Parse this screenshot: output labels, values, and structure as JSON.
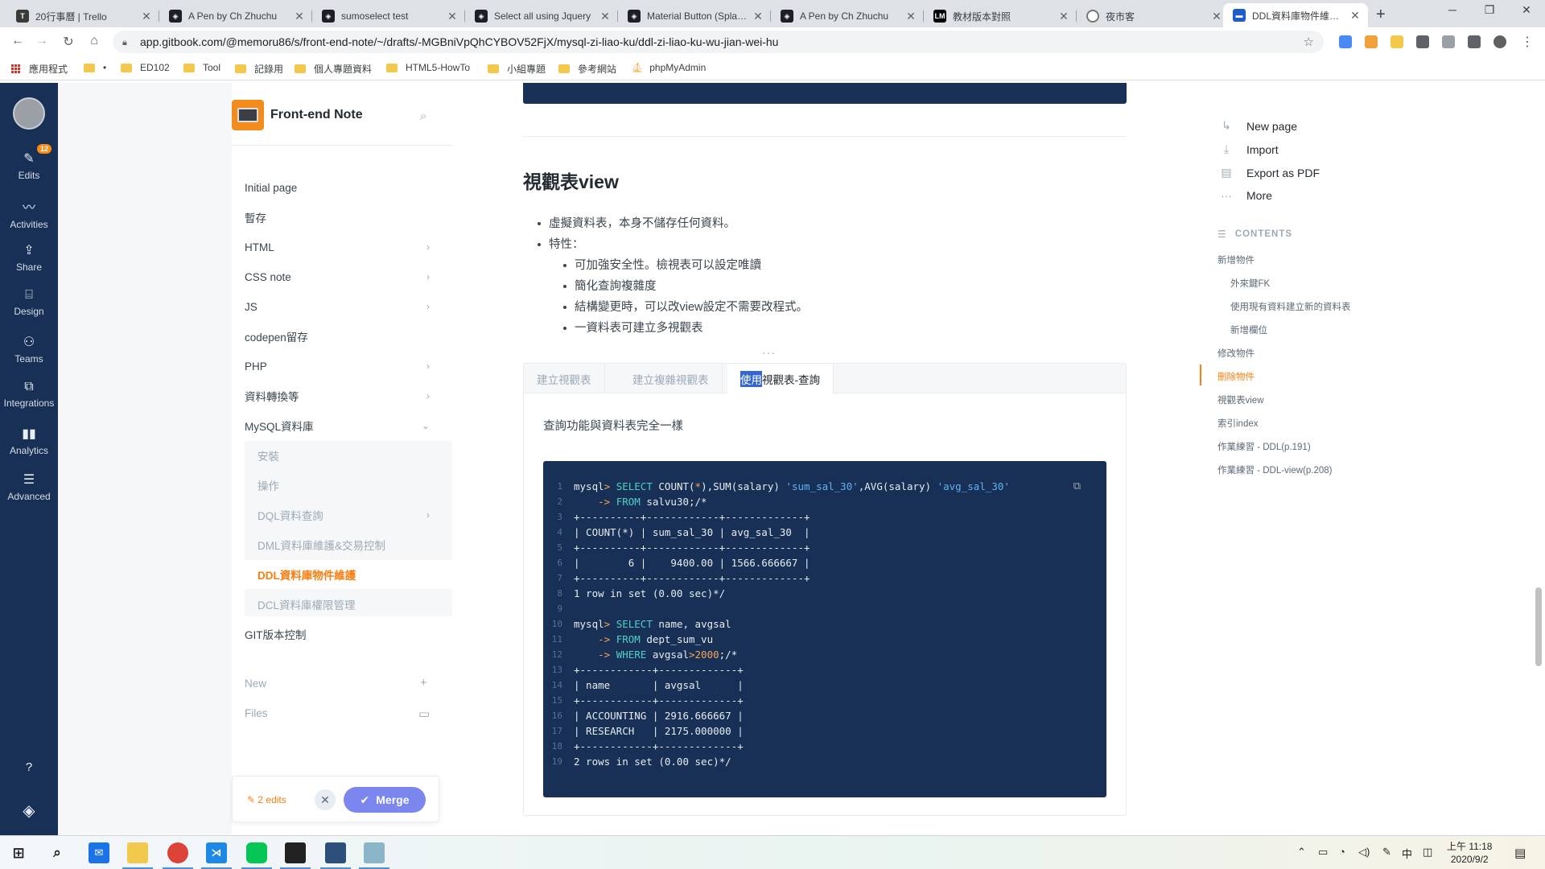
{
  "browser": {
    "tabs": [
      {
        "title": "20行事曆 | Trello",
        "icon_color": "#3a3a3a"
      },
      {
        "title": "A Pen by Ch Zhuchu",
        "icon_color": "#1e1f26"
      },
      {
        "title": "sumoselect test",
        "icon_color": "#1e1f26"
      },
      {
        "title": "Select all using Jquery",
        "icon_color": "#1e1f26"
      },
      {
        "title": "Material Button (Splash)",
        "icon_color": "#1e1f26"
      },
      {
        "title": "A Pen by Ch Zhuchu",
        "icon_color": "#1e1f26"
      },
      {
        "title": "教材版本對照",
        "icon_color": "#000000"
      },
      {
        "title": "夜市客",
        "icon_color": "#777777"
      },
      {
        "title": "DDL資料庫物件維護 - Fron",
        "icon_color": "#1e5bcc"
      }
    ],
    "url": "app.gitbook.com/@memoru86/s/front-end-note/~/drafts/-MGBniVpQhCYBOV52FjX/mysql-zi-liao-ku/ddl-zi-liao-ku-wu-jian-wei-hu",
    "bookmarks": [
      "應用程式",
      "•",
      "ED102",
      "Tool",
      "記錄用",
      "個人專題資料",
      "HTML5-HowTo",
      "小組專題",
      "參考網站",
      "phpMyAdmin"
    ]
  },
  "leftbar": {
    "edits_badge": "12",
    "items": [
      {
        "label": "Edits",
        "icon": "pencil-icon"
      },
      {
        "label": "Activities",
        "icon": "activity-icon"
      },
      {
        "label": "Share",
        "icon": "share-icon"
      },
      {
        "label": "Design",
        "icon": "design-icon"
      },
      {
        "label": "Teams",
        "icon": "teams-icon"
      },
      {
        "label": "Integrations",
        "icon": "integrations-icon"
      },
      {
        "label": "Analytics",
        "icon": "analytics-icon"
      },
      {
        "label": "Advanced",
        "icon": "advanced-icon"
      }
    ]
  },
  "sidebar": {
    "space_name": "Front-end Note",
    "items": [
      {
        "label": "Initial page",
        "chevron": false
      },
      {
        "label": "暫存",
        "chevron": false
      },
      {
        "label": "HTML",
        "chevron": true
      },
      {
        "label": "CSS note",
        "chevron": true
      },
      {
        "label": "JS",
        "chevron": true
      },
      {
        "label": "codepen留存",
        "chevron": false
      },
      {
        "label": "PHP",
        "chevron": true
      },
      {
        "label": "資料轉換等",
        "chevron": true
      },
      {
        "label": "MySQL資料庫",
        "chevron": true
      }
    ],
    "subitems": [
      {
        "label": "安裝"
      },
      {
        "label": "操作"
      },
      {
        "label": "DQL資料查詢"
      },
      {
        "label": "DML資料庫維護&交易控制"
      },
      {
        "label": "DDL資料庫物件維護"
      },
      {
        "label": "DCL資料庫權限管理"
      }
    ],
    "after": "GIT版本控制",
    "new_label": "New",
    "files_label": "Files",
    "edits_label": "2 edits",
    "merge_label": "Merge"
  },
  "main": {
    "heading": "視觀表view",
    "bullets": [
      "虛擬資料表，本身不儲存任何資料。",
      "特性："
    ],
    "sub_bullets": [
      "可加強安全性。檢視表可以設定唯讀",
      "簡化查詢複雜度",
      "結構變更時，可以改view設定不需要改程式。",
      "一資料表可建立多視觀表"
    ],
    "tabs": [
      "建立視觀表",
      "建立複雜視觀表"
    ],
    "active_tab_hl": "使用",
    "active_tab_rest": "視觀表-查詢",
    "tab_text": "查詢功能與資料表完全一樣",
    "code": [
      {
        "n": "1",
        "parts": [
          [
            "p",
            "mysql"
          ],
          [
            "o",
            "> "
          ],
          [
            "k",
            "SELECT "
          ],
          [
            "p",
            "COUNT("
          ],
          [
            "o",
            "*"
          ],
          [
            "p",
            "),SUM(salary) "
          ],
          [
            "s",
            "'sum_sal_30'"
          ],
          [
            "p",
            ",AVG(salary) "
          ],
          [
            "s",
            "'avg_sal_30'"
          ]
        ]
      },
      {
        "n": "2",
        "parts": [
          [
            "p",
            "    "
          ],
          [
            "o",
            "-> "
          ],
          [
            "k",
            "FROM "
          ],
          [
            "p",
            "salvu30;/*"
          ]
        ]
      },
      {
        "n": "3",
        "parts": [
          [
            "p",
            "+----------+------------+-------------+"
          ]
        ]
      },
      {
        "n": "4",
        "parts": [
          [
            "p",
            "| COUNT(*) | sum_sal_30 | avg_sal_30  |"
          ]
        ]
      },
      {
        "n": "5",
        "parts": [
          [
            "p",
            "+----------+------------+-------------+"
          ]
        ]
      },
      {
        "n": "6",
        "parts": [
          [
            "p",
            "|        6 |    9400.00 | 1566.666667 |"
          ]
        ]
      },
      {
        "n": "7",
        "parts": [
          [
            "p",
            "+----------+------------+-------------+"
          ]
        ]
      },
      {
        "n": "8",
        "parts": [
          [
            "p",
            "1 row in set (0.00 sec)*/"
          ]
        ]
      },
      {
        "n": "9",
        "parts": [
          [
            "p",
            ""
          ]
        ]
      },
      {
        "n": "10",
        "parts": [
          [
            "p",
            "mysql"
          ],
          [
            "o",
            "> "
          ],
          [
            "k",
            "SELECT "
          ],
          [
            "p",
            "name, avgsal"
          ]
        ]
      },
      {
        "n": "11",
        "parts": [
          [
            "p",
            "    "
          ],
          [
            "o",
            "-> "
          ],
          [
            "k",
            "FROM "
          ],
          [
            "p",
            "dept_sum_vu"
          ]
        ]
      },
      {
        "n": "12",
        "parts": [
          [
            "p",
            "    "
          ],
          [
            "o",
            "-> "
          ],
          [
            "k",
            "WHERE "
          ],
          [
            "p",
            "avgsal"
          ],
          [
            "o",
            ">2000"
          ],
          [
            "p",
            ";/*"
          ]
        ]
      },
      {
        "n": "13",
        "parts": [
          [
            "p",
            "+------------+-------------+"
          ]
        ]
      },
      {
        "n": "14",
        "parts": [
          [
            "p",
            "| name       | avgsal      |"
          ]
        ]
      },
      {
        "n": "15",
        "parts": [
          [
            "p",
            "+------------+-------------+"
          ]
        ]
      },
      {
        "n": "16",
        "parts": [
          [
            "p",
            "| ACCOUNTING | 2916.666667 |"
          ]
        ]
      },
      {
        "n": "17",
        "parts": [
          [
            "p",
            "| RESEARCH   | 2175.000000 |"
          ]
        ]
      },
      {
        "n": "18",
        "parts": [
          [
            "p",
            "+------------+-------------+"
          ]
        ]
      },
      {
        "n": "19",
        "parts": [
          [
            "p",
            "2 rows in set (0.00 sec)*/"
          ]
        ]
      }
    ]
  },
  "right": {
    "actions": [
      {
        "label": "New page",
        "icon": "new-page-icon"
      },
      {
        "label": "Import",
        "icon": "import-icon"
      },
      {
        "label": "Export as PDF",
        "icon": "pdf-icon"
      },
      {
        "label": "More",
        "icon": "more-icon"
      }
    ],
    "contents_label": "CONTENTS",
    "toc": [
      {
        "label": "新增物件",
        "sub": false,
        "active": false
      },
      {
        "label": "外來鍵FK",
        "sub": true,
        "active": false
      },
      {
        "label": "使用現有資料建立新的資料表",
        "sub": true,
        "active": false
      },
      {
        "label": "新增欄位",
        "sub": true,
        "active": false
      },
      {
        "label": "修改物件",
        "sub": false,
        "active": false
      },
      {
        "label": "刪除物件",
        "sub": false,
        "active": true
      },
      {
        "label": "視觀表view",
        "sub": false,
        "active": false
      },
      {
        "label": "索引index",
        "sub": false,
        "active": false
      },
      {
        "label": "作業練習 - DDL(p.191)",
        "sub": false,
        "active": false
      },
      {
        "label": "作業練習 - DDL-view(p.208)",
        "sub": false,
        "active": false
      }
    ]
  },
  "taskbar": {
    "time": "上午 11:18",
    "date": "2020/9/2",
    "ime": "中"
  },
  "colors": {
    "accent": "#fa7d0f",
    "navy": "#183055",
    "merge": "#7b86ee"
  }
}
